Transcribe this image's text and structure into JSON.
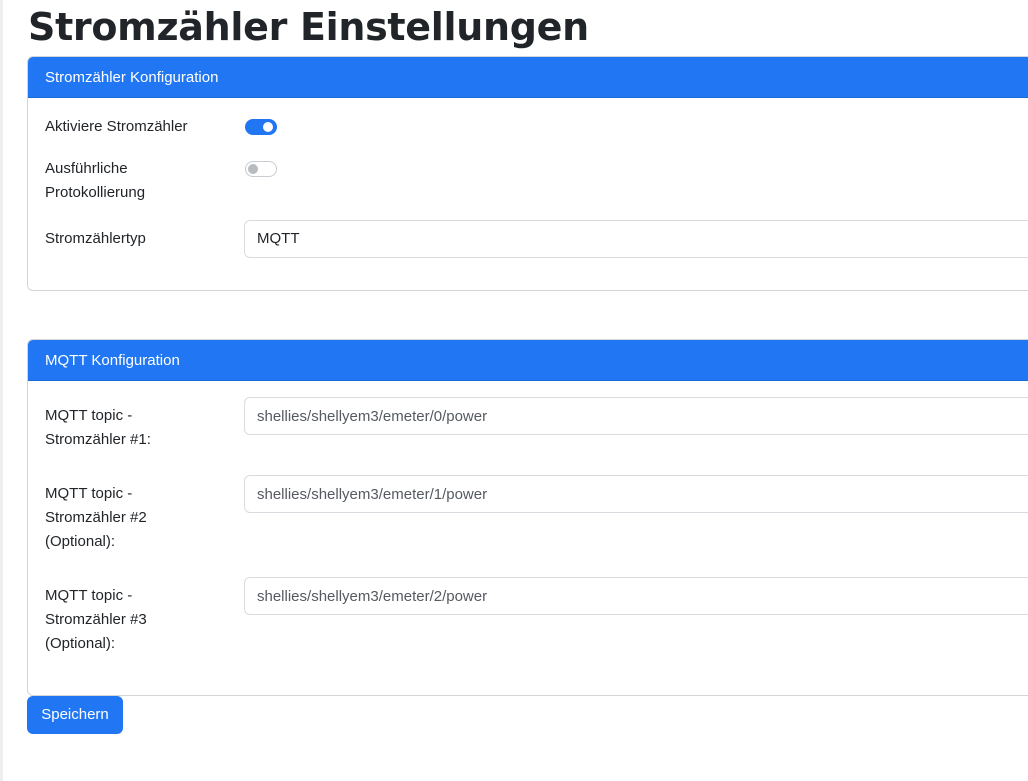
{
  "page": {
    "title": "Stromzähler Einstellungen"
  },
  "meter_config": {
    "header": "Stromzähler Konfiguration",
    "enable": {
      "label": "Aktiviere Stromzähler",
      "checked": true
    },
    "verbose": {
      "label_line1": "Ausführliche",
      "label_line2": "Protokollierung",
      "checked": false
    },
    "type": {
      "label": "Stromzählertyp",
      "value": "MQTT"
    }
  },
  "mqtt_config": {
    "header": "MQTT Konfiguration",
    "topics": [
      {
        "label_lines": [
          "MQTT topic -",
          "Stromzähler #1:"
        ],
        "value": "shellies/shellyem3/emeter/0/power"
      },
      {
        "label_lines": [
          "MQTT topic -",
          "Stromzähler #2",
          "(Optional):"
        ],
        "value": "shellies/shellyem3/emeter/1/power"
      },
      {
        "label_lines": [
          "MQTT topic -",
          "Stromzähler #3",
          "(Optional):"
        ],
        "value": "shellies/shellyem3/emeter/2/power"
      }
    ]
  },
  "actions": {
    "save_label": "Speichern"
  },
  "colors": {
    "primary": "#2176f3",
    "text": "#212529",
    "border": "#d3d6d9"
  }
}
